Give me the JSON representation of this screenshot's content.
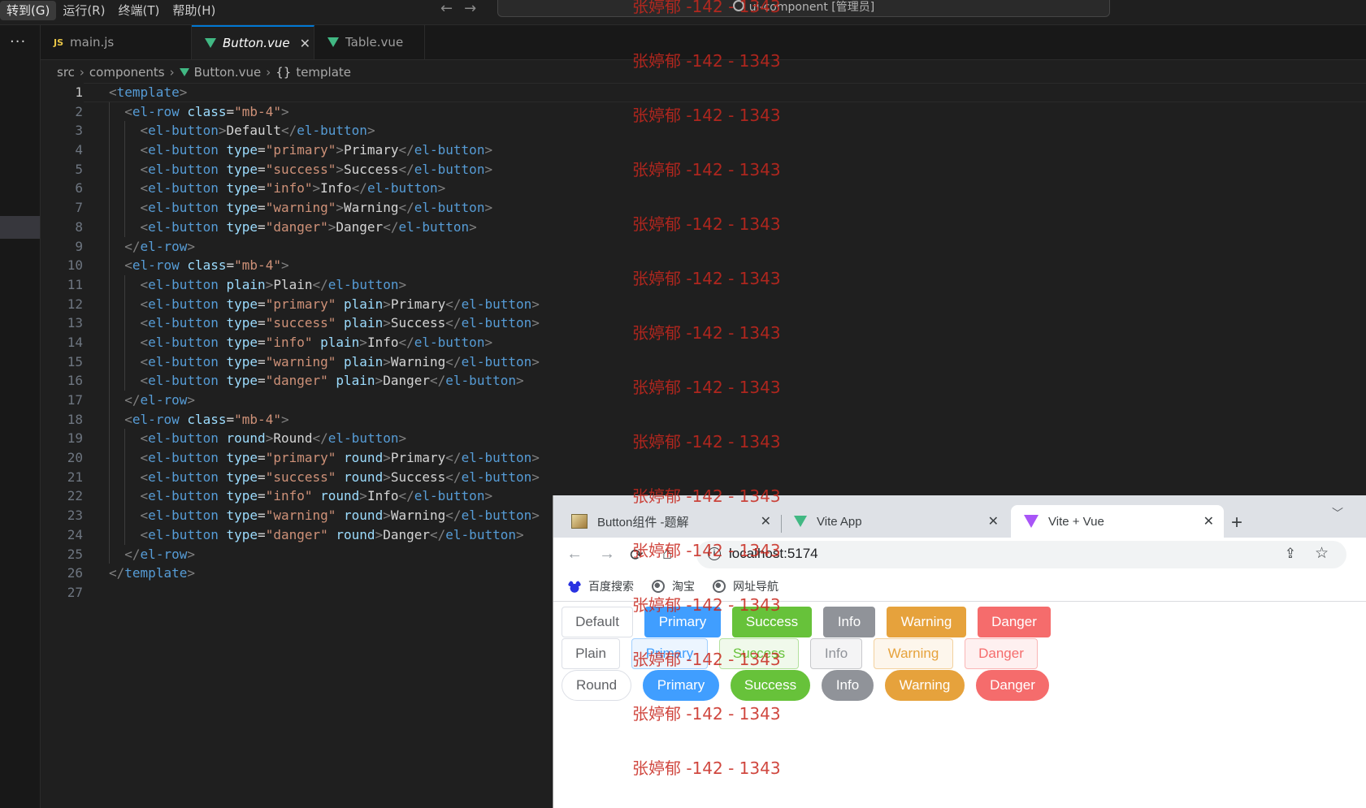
{
  "menu": [
    "转到(G)",
    "运行(R)",
    "终端(T)",
    "帮助(H)"
  ],
  "command_center": "ui-component [管理员]",
  "activity_dots": "···",
  "tabs": [
    {
      "badge": "JS",
      "label": "main.js"
    },
    {
      "label": "Button.vue",
      "close": "✕"
    },
    {
      "label": "Table.vue"
    }
  ],
  "breadcrumb": {
    "src": "src",
    "components": "components",
    "file": "Button.vue",
    "braces": "{}",
    "template": "template"
  },
  "editor": {
    "line_numbers": [
      "1",
      "2",
      "3",
      "4",
      "5",
      "6",
      "7",
      "8",
      "9",
      "10",
      "11",
      "12",
      "13",
      "14",
      "15",
      "16",
      "17",
      "18",
      "19",
      "20",
      "21",
      "22",
      "23",
      "24",
      "25",
      "26",
      "27"
    ],
    "lines": [
      "<template>",
      "  <el-row class=\"mb-4\">",
      "    <el-button>Default</el-button>",
      "    <el-button type=\"primary\">Primary</el-button>",
      "    <el-button type=\"success\">Success</el-button>",
      "    <el-button type=\"info\">Info</el-button>",
      "    <el-button type=\"warning\">Warning</el-button>",
      "    <el-button type=\"danger\">Danger</el-button>",
      "  </el-row>",
      "  <el-row class=\"mb-4\">",
      "    <el-button plain>Plain</el-button>",
      "    <el-button type=\"primary\" plain>Primary</el-button>",
      "    <el-button type=\"success\" plain>Success</el-button>",
      "    <el-button type=\"info\" plain>Info</el-button>",
      "    <el-button type=\"warning\" plain>Warning</el-button>",
      "    <el-button type=\"danger\" plain>Danger</el-button>",
      "  </el-row>",
      "  <el-row class=\"mb-4\">",
      "    <el-button round>Round</el-button>",
      "    <el-button type=\"primary\" round>Primary</el-button>",
      "    <el-button type=\"success\" round>Success</el-button>",
      "    <el-button type=\"info\" round>Info</el-button>",
      "    <el-button type=\"warning\" round>Warning</el-button>",
      "    <el-button type=\"danger\" round>Danger</el-button>",
      "  </el-row>",
      "</template>",
      ""
    ]
  },
  "browser": {
    "tabs": [
      {
        "title": "Button组件 -题解",
        "close": "✕"
      },
      {
        "title": "Vite App",
        "close": "✕"
      },
      {
        "title": "Vite + Vue",
        "close": "✕"
      }
    ],
    "new_tab": "+",
    "tab_menu": "﹀",
    "nav": {
      "back": "←",
      "forward": "→",
      "reload": "⟳",
      "home": "⌂"
    },
    "url": "localhost:5174",
    "info_glyph": "i",
    "share_glyph": "⇪",
    "star_glyph": "☆",
    "bookmarks": [
      "百度搜索",
      "淘宝",
      "网址导航"
    ]
  },
  "colors": {
    "primary": "#409eff",
    "success": "#67c23a",
    "info": "#909399",
    "warning": "#e6a23c",
    "danger": "#f56c6c",
    "primary_plain_bg": "#ecf5ff",
    "primary_plain_border": "#a0cfff",
    "success_plain_bg": "#f0f9eb",
    "success_plain_border": "#b3e19d",
    "info_plain_bg": "#f4f4f5",
    "info_plain_border": "#c8c9cc",
    "warning_plain_bg": "#fdf6ec",
    "warning_plain_border": "#f3d19e",
    "danger_plain_bg": "#fef0f0",
    "danger_plain_border": "#fab6b6"
  },
  "demo_rows": [
    [
      {
        "label": "Default",
        "type": "default"
      },
      {
        "label": "Primary",
        "type": "primary"
      },
      {
        "label": "Success",
        "type": "success"
      },
      {
        "label": "Info",
        "type": "info"
      },
      {
        "label": "Warning",
        "type": "warning"
      },
      {
        "label": "Danger",
        "type": "danger"
      }
    ],
    [
      {
        "label": "Plain",
        "type": "default"
      },
      {
        "label": "Primary",
        "type": "primary"
      },
      {
        "label": "Success",
        "type": "success"
      },
      {
        "label": "Info",
        "type": "info"
      },
      {
        "label": "Warning",
        "type": "warning"
      },
      {
        "label": "Danger",
        "type": "danger"
      }
    ],
    [
      {
        "label": "Round",
        "type": "default"
      },
      {
        "label": "Primary",
        "type": "primary"
      },
      {
        "label": "Success",
        "type": "success"
      },
      {
        "label": "Info",
        "type": "info"
      },
      {
        "label": "Warning",
        "type": "warning"
      },
      {
        "label": "Danger",
        "type": "danger"
      }
    ]
  ],
  "watermark": [
    "张婷郁 -142 - 1343",
    "张婷郁 -142 - 1343",
    "张婷郁 -142 - 1343",
    "张婷郁 -142 - 1343",
    "张婷郁 -142 - 1343",
    "张婷郁 -142 - 1343",
    "张婷郁 -142 - 1343",
    "张婷郁 -142 - 1343",
    "张婷郁 -142 - 1343",
    "张婷郁 -142 - 1343",
    "张婷郁 -142 - 1343",
    "张婷郁 -142 - 1343",
    "张婷郁 -142 - 1343",
    "张婷郁 -142 - 1343",
    "张婷郁 -142 - 1343"
  ]
}
